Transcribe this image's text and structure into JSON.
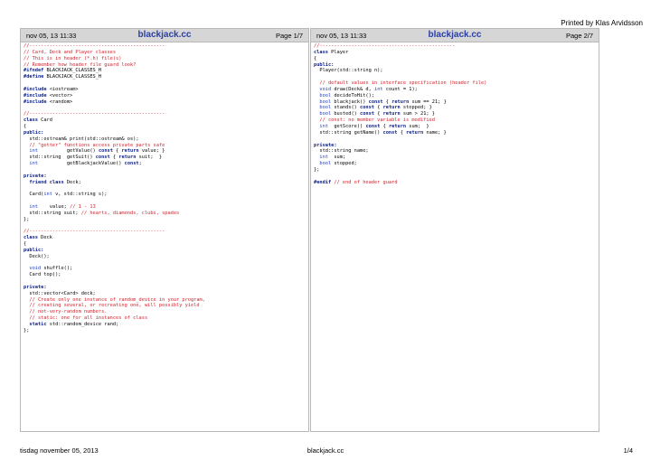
{
  "printed_by": "Printed by Klas Arvidsson",
  "pages": [
    {
      "date": "nov 05, 13 11:33",
      "title": "blackjack.cc",
      "page": "Page 1/7",
      "lines": [
        [
          {
            "t": "//-----------------------------------------------",
            "c": "comment"
          }
        ],
        [
          {
            "t": "// Card, Deck and Player classes",
            "c": "comment"
          }
        ],
        [
          {
            "t": "// This is in header (*.h) file(s)",
            "c": "comment"
          }
        ],
        [
          {
            "t": "// Remember how header file guard look?",
            "c": "comment"
          }
        ],
        [
          {
            "t": "#ifndef",
            "c": "kw"
          },
          {
            "t": " BLACKJACK_CLASSES_H"
          }
        ],
        [
          {
            "t": "#define",
            "c": "kw"
          },
          {
            "t": " BLACKJACK_CLASSES_H"
          }
        ],
        [],
        [
          {
            "t": "#include",
            "c": "kw"
          },
          {
            "t": " <iostream>"
          }
        ],
        [
          {
            "t": "#include",
            "c": "kw"
          },
          {
            "t": " <vector>"
          }
        ],
        [
          {
            "t": "#include",
            "c": "kw"
          },
          {
            "t": " <random>"
          }
        ],
        [],
        [
          {
            "t": "//-----------------------------------------------",
            "c": "comment"
          }
        ],
        [
          {
            "t": "class",
            "c": "kw"
          },
          {
            "t": " Card"
          }
        ],
        [
          {
            "t": "{"
          }
        ],
        [
          {
            "t": "public:",
            "c": "kw"
          }
        ],
        [
          {
            "t": "  std::ostream& print(std::ostream& os);"
          }
        ],
        [
          {
            "t": "  // \"getter\" functions access private parts safe",
            "c": "comment"
          }
        ],
        [
          {
            "t": "  "
          },
          {
            "t": "int",
            "c": "typ"
          },
          {
            "t": "          getValue() "
          },
          {
            "t": "const",
            "c": "kw"
          },
          {
            "t": " { "
          },
          {
            "t": "return",
            "c": "kw"
          },
          {
            "t": " value; }"
          }
        ],
        [
          {
            "t": "  std::string  getSuit() "
          },
          {
            "t": "const",
            "c": "kw"
          },
          {
            "t": " { "
          },
          {
            "t": "return",
            "c": "kw"
          },
          {
            "t": " suit;  }"
          }
        ],
        [
          {
            "t": "  "
          },
          {
            "t": "int",
            "c": "typ"
          },
          {
            "t": "          getBlackjackValue() "
          },
          {
            "t": "const",
            "c": "kw"
          },
          {
            "t": ";"
          }
        ],
        [],
        [
          {
            "t": "private:",
            "c": "kw"
          }
        ],
        [
          {
            "t": "  "
          },
          {
            "t": "friend class",
            "c": "kw"
          },
          {
            "t": " Deck;"
          }
        ],
        [],
        [
          {
            "t": "  Card("
          },
          {
            "t": "int",
            "c": "typ"
          },
          {
            "t": " v, std::string s);"
          }
        ],
        [],
        [
          {
            "t": "  "
          },
          {
            "t": "int",
            "c": "typ"
          },
          {
            "t": "    value; "
          },
          {
            "t": "// 1 - 13",
            "c": "comment"
          }
        ],
        [
          {
            "t": "  std::string suit; "
          },
          {
            "t": "// hearts, diamonds, clubs, spades",
            "c": "comment"
          }
        ],
        [
          {
            "t": "};"
          }
        ],
        [],
        [
          {
            "t": "//-----------------------------------------------",
            "c": "comment"
          }
        ],
        [
          {
            "t": "class",
            "c": "kw"
          },
          {
            "t": " Deck"
          }
        ],
        [
          {
            "t": "{"
          }
        ],
        [
          {
            "t": "public:",
            "c": "kw"
          }
        ],
        [
          {
            "t": "  Deck();"
          }
        ],
        [],
        [
          {
            "t": "  "
          },
          {
            "t": "void",
            "c": "typ"
          },
          {
            "t": " shuffle();"
          }
        ],
        [
          {
            "t": "  Card top();"
          }
        ],
        [],
        [
          {
            "t": "private:",
            "c": "kw"
          }
        ],
        [
          {
            "t": "  std::vector<Card> deck;"
          }
        ],
        [
          {
            "t": "  // Create only one instance of random_device in your program,",
            "c": "comment"
          }
        ],
        [
          {
            "t": "  // creating several, or recreating one, will possibly yield",
            "c": "comment"
          }
        ],
        [
          {
            "t": "  // not-very-random numbers.",
            "c": "comment"
          }
        ],
        [
          {
            "t": "  // static: one for all instances of class",
            "c": "comment"
          }
        ],
        [
          {
            "t": "  "
          },
          {
            "t": "static",
            "c": "kw"
          },
          {
            "t": " std::random_device rand;"
          }
        ],
        [
          {
            "t": "};"
          }
        ]
      ]
    },
    {
      "date": "nov 05, 13 11:33",
      "title": "blackjack.cc",
      "page": "Page 2/7",
      "lines": [
        [
          {
            "t": "//-----------------------------------------------",
            "c": "comment"
          }
        ],
        [
          {
            "t": "class",
            "c": "kw"
          },
          {
            "t": " Player"
          }
        ],
        [
          {
            "t": "{"
          }
        ],
        [
          {
            "t": "public:",
            "c": "kw"
          }
        ],
        [
          {
            "t": "  Player(std::string n);"
          }
        ],
        [],
        [
          {
            "t": "  // default values in interface specification (header file)",
            "c": "comment"
          }
        ],
        [
          {
            "t": "  "
          },
          {
            "t": "void",
            "c": "typ"
          },
          {
            "t": " draw(Deck& d, "
          },
          {
            "t": "int",
            "c": "typ"
          },
          {
            "t": " count = 1);"
          }
        ],
        [
          {
            "t": "  "
          },
          {
            "t": "bool",
            "c": "typ"
          },
          {
            "t": " decideToHit();"
          }
        ],
        [
          {
            "t": "  "
          },
          {
            "t": "bool",
            "c": "typ"
          },
          {
            "t": " blackjack() "
          },
          {
            "t": "const",
            "c": "kw"
          },
          {
            "t": " { "
          },
          {
            "t": "return",
            "c": "kw"
          },
          {
            "t": " sum == 21; }"
          }
        ],
        [
          {
            "t": "  "
          },
          {
            "t": "bool",
            "c": "typ"
          },
          {
            "t": " stands() "
          },
          {
            "t": "const",
            "c": "kw"
          },
          {
            "t": " { "
          },
          {
            "t": "return",
            "c": "kw"
          },
          {
            "t": " stopped; }"
          }
        ],
        [
          {
            "t": "  "
          },
          {
            "t": "bool",
            "c": "typ"
          },
          {
            "t": " busted() "
          },
          {
            "t": "const",
            "c": "kw"
          },
          {
            "t": " { "
          },
          {
            "t": "return",
            "c": "kw"
          },
          {
            "t": " sum > 21; }"
          }
        ],
        [
          {
            "t": "  // const: no member variable is modified",
            "c": "comment"
          }
        ],
        [
          {
            "t": "  "
          },
          {
            "t": "int",
            "c": "typ"
          },
          {
            "t": "  getScore() "
          },
          {
            "t": "const",
            "c": "kw"
          },
          {
            "t": " { "
          },
          {
            "t": "return",
            "c": "kw"
          },
          {
            "t": " sum;  }"
          }
        ],
        [
          {
            "t": "  std::string getName() "
          },
          {
            "t": "const",
            "c": "kw"
          },
          {
            "t": " { "
          },
          {
            "t": "return",
            "c": "kw"
          },
          {
            "t": " name; }"
          }
        ],
        [],
        [
          {
            "t": "private:",
            "c": "kw"
          }
        ],
        [
          {
            "t": "  std::string name;"
          }
        ],
        [
          {
            "t": "  "
          },
          {
            "t": "int",
            "c": "typ"
          },
          {
            "t": "  sum;"
          }
        ],
        [
          {
            "t": "  "
          },
          {
            "t": "bool",
            "c": "typ"
          },
          {
            "t": " stopped;"
          }
        ],
        [
          {
            "t": "};"
          }
        ],
        [],
        [
          {
            "t": "#endif",
            "c": "kw"
          },
          {
            "t": " "
          },
          {
            "t": "// end of header guard",
            "c": "comment"
          }
        ]
      ]
    }
  ],
  "footer": {
    "left": "tisdag november 05, 2013",
    "center": "blackjack.cc",
    "right": "1/4"
  }
}
